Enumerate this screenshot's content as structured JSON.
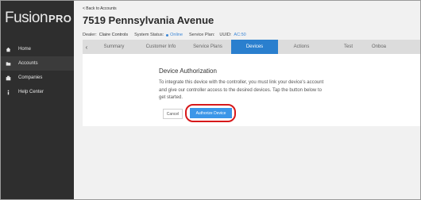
{
  "logo": {
    "main": "Fusion",
    "sub": "PRO"
  },
  "sidebar": {
    "items": [
      {
        "label": "Home",
        "icon": "home-icon"
      },
      {
        "label": "Accounts",
        "icon": "folder-icon"
      },
      {
        "label": "Companies",
        "icon": "building-icon"
      },
      {
        "label": "Help Center",
        "icon": "info-icon"
      }
    ]
  },
  "main": {
    "back_link": "< Back to Accounts",
    "title": "7519 Pennsylvania Avenue",
    "meta": {
      "dealer_label": "Dealer:",
      "dealer_value": "Claire Controls",
      "status_label": "System Status:",
      "status_value": "Online",
      "plan_label": "Service Plan:",
      "uuid_label": "UUID:",
      "uuid_value": "AC:50"
    },
    "tabs": [
      "Summary",
      "Customer Info",
      "Service Plans",
      "Devices",
      "Actions",
      "Test",
      "Onboa"
    ],
    "active_tab": "Devices"
  },
  "card": {
    "title": "Device Authorization",
    "body": "To integrate this device with the controller, you must link your device's account and give our controller access to the desired devices. Tap the button below to get started.",
    "cancel_label": "Cancel",
    "authorize_label": "Authorize Device"
  },
  "colors": {
    "sidebar_bg": "#2e2e2e",
    "accent": "#2a7fce",
    "button": "#3b96e8",
    "highlight": "#d7191b"
  }
}
